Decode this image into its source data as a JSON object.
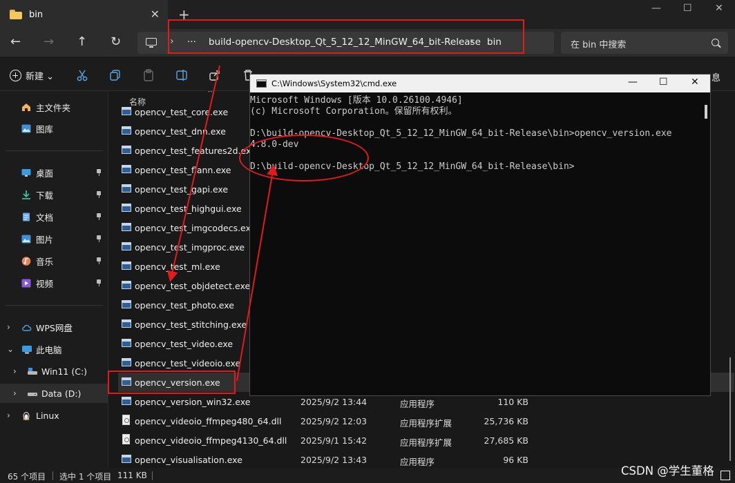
{
  "tab": {
    "title": "bin",
    "close": "✕",
    "new_tab": "+"
  },
  "window_controls": {
    "minimize": "—",
    "maximize": "☐",
    "close": "✕"
  },
  "nav": {
    "back": "←",
    "forward": "→",
    "up": "↑",
    "refresh": "↻"
  },
  "address": {
    "ellipsis": "···",
    "crumbs": [
      "build-opencv-Desktop_Qt_5_12_12_MinGW_64_bit-Release",
      "bin"
    ],
    "sep": "›"
  },
  "search": {
    "placeholder": "在 bin 中搜索"
  },
  "toolbar": {
    "new_label": "新建 ⌄",
    "right_label": "息"
  },
  "sidebar": {
    "items": [
      {
        "label": "主文件夹",
        "icon": "home-icon"
      },
      {
        "label": "图库",
        "icon": "gallery-icon"
      },
      {
        "label": "桌面",
        "icon": "desktop-icon",
        "pinned": true
      },
      {
        "label": "下载",
        "icon": "download-icon",
        "pinned": true
      },
      {
        "label": "文档",
        "icon": "documents-icon",
        "pinned": true
      },
      {
        "label": "图片",
        "icon": "pictures-icon",
        "pinned": true
      },
      {
        "label": "音乐",
        "icon": "music-icon",
        "pinned": true
      },
      {
        "label": "视频",
        "icon": "videos-icon",
        "pinned": true
      },
      {
        "label": "WPS网盘",
        "icon": "cloud-icon"
      },
      {
        "label": "此电脑",
        "icon": "this-pc-icon"
      },
      {
        "label": "Win11 (C:)",
        "icon": "drive-c-icon"
      },
      {
        "label": "Data (D:)",
        "icon": "drive-d-icon"
      },
      {
        "label": "Linux",
        "icon": "linux-icon"
      }
    ]
  },
  "filelist": {
    "column_name": "名称",
    "sort_arrow": "^",
    "rows": [
      {
        "name": "opencv_test_core.exe",
        "date": "",
        "type": "",
        "size": "",
        "kind": "exe"
      },
      {
        "name": "opencv_test_dnn.exe",
        "date": "",
        "type": "",
        "size": "",
        "kind": "exe"
      },
      {
        "name": "opencv_test_features2d.exe",
        "date": "",
        "type": "",
        "size": "",
        "kind": "exe"
      },
      {
        "name": "opencv_test_flann.exe",
        "date": "",
        "type": "",
        "size": "",
        "kind": "exe"
      },
      {
        "name": "opencv_test_gapi.exe",
        "date": "",
        "type": "",
        "size": "",
        "kind": "exe"
      },
      {
        "name": "opencv_test_highgui.exe",
        "date": "",
        "type": "",
        "size": "",
        "kind": "exe"
      },
      {
        "name": "opencv_test_imgcodecs.exe",
        "date": "",
        "type": "",
        "size": "",
        "kind": "exe"
      },
      {
        "name": "opencv_test_imgproc.exe",
        "date": "",
        "type": "",
        "size": "",
        "kind": "exe"
      },
      {
        "name": "opencv_test_ml.exe",
        "date": "",
        "type": "",
        "size": "",
        "kind": "exe"
      },
      {
        "name": "opencv_test_objdetect.exe",
        "date": "",
        "type": "",
        "size": "",
        "kind": "exe"
      },
      {
        "name": "opencv_test_photo.exe",
        "date": "",
        "type": "",
        "size": "",
        "kind": "exe"
      },
      {
        "name": "opencv_test_stitching.exe",
        "date": "",
        "type": "",
        "size": "",
        "kind": "exe"
      },
      {
        "name": "opencv_test_video.exe",
        "date": "",
        "type": "",
        "size": "",
        "kind": "exe"
      },
      {
        "name": "opencv_test_videoio.exe",
        "date": "",
        "type": "",
        "size": "",
        "kind": "exe"
      },
      {
        "name": "opencv_version.exe",
        "date": "",
        "type": "",
        "size": "",
        "kind": "exe",
        "selected": true
      },
      {
        "name": "opencv_version_win32.exe",
        "date": "2025/9/2 13:44",
        "type": "应用程序",
        "size": "110 KB",
        "kind": "exe"
      },
      {
        "name": "opencv_videoio_ffmpeg480_64.dll",
        "date": "2025/9/2 12:03",
        "type": "应用程序扩展",
        "size": "25,736 KB",
        "kind": "dll"
      },
      {
        "name": "opencv_videoio_ffmpeg4130_64.dll",
        "date": "2025/9/1 15:42",
        "type": "应用程序扩展",
        "size": "27,685 KB",
        "kind": "dll"
      },
      {
        "name": "opencv_visualisation.exe",
        "date": "2025/9/2 13:43",
        "type": "应用程序",
        "size": "96 KB",
        "kind": "exe"
      }
    ]
  },
  "status": {
    "count": "65 个项目",
    "selected": "选中 1 个项目",
    "size": "111 KB",
    "sep": "|"
  },
  "watermark": "CSDN @学生董格",
  "cmd": {
    "title": "C:\\Windows\\System32\\cmd.exe",
    "controls": {
      "minimize": "—",
      "maximize": "☐",
      "close": "✕"
    },
    "lines": [
      "Microsoft Windows [版本 10.0.26100.4946]",
      "(c) Microsoft Corporation。保留所有权利。",
      "",
      "D:\\build-opencv-Desktop_Qt_5_12_12_MinGW_64_bit-Release\\bin>opencv_version.exe",
      "4.8.0-dev",
      "",
      "D:\\build-opencv-Desktop_Qt_5_12_12_MinGW_64_bit-Release\\bin>"
    ]
  },
  "colors": {
    "annotation": "#e21b1b",
    "background": "#1c1c1c",
    "cmd_background": "#0c0c0c",
    "folder": "#f4c85b"
  }
}
